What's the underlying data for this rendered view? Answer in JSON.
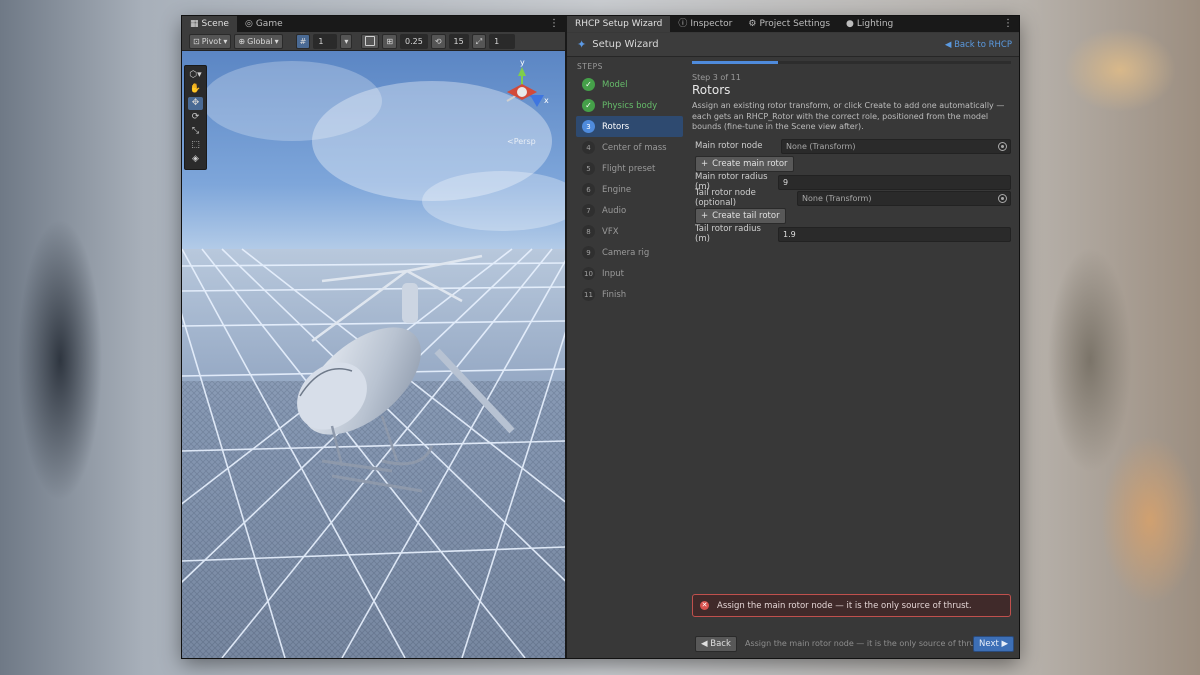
{
  "scene_panel": {
    "tabs": [
      {
        "label": "Scene",
        "icon": "grid-icon"
      },
      {
        "label": "Game",
        "icon": "gamepad-icon"
      }
    ],
    "toolbar": {
      "pivot": "Pivot",
      "global": "Global",
      "grid_value": "1",
      "snap_value": "0.25",
      "rotate_snap": "15",
      "scale_snap": "1"
    },
    "camera_mode": "<Persp"
  },
  "wizard_panel": {
    "tabs": [
      {
        "label": "RHCP Setup Wizard",
        "icon": ""
      },
      {
        "label": "Inspector",
        "icon": "info-icon"
      },
      {
        "label": "Project Settings",
        "icon": "gear-icon"
      },
      {
        "label": "Lighting",
        "icon": "bulb-icon"
      }
    ],
    "header": {
      "title": "Setup Wizard",
      "back_link": "◀ Back to RHCP"
    },
    "progress": 0.27,
    "steps_heading": "STEPS",
    "steps": [
      {
        "num": "✓",
        "label": "Model",
        "state": "done"
      },
      {
        "num": "✓",
        "label": "Physics body",
        "state": "done"
      },
      {
        "num": "3",
        "label": "Rotors",
        "state": "active"
      },
      {
        "num": "4",
        "label": "Center of mass",
        "state": "pending"
      },
      {
        "num": "5",
        "label": "Flight preset",
        "state": "pending"
      },
      {
        "num": "6",
        "label": "Engine",
        "state": "pending"
      },
      {
        "num": "7",
        "label": "Audio",
        "state": "pending"
      },
      {
        "num": "8",
        "label": "VFX",
        "state": "pending"
      },
      {
        "num": "9",
        "label": "Camera rig",
        "state": "pending"
      },
      {
        "num": "10",
        "label": "Input",
        "state": "pending"
      },
      {
        "num": "11",
        "label": "Finish",
        "state": "pending"
      }
    ],
    "content": {
      "step_count": "Step 3 of 11",
      "title": "Rotors",
      "description": "Assign an existing rotor transform, or click Create to add one automatically — each gets an RHCP_Rotor with the correct role, positioned from the model bounds (fine-tune in the Scene view after).",
      "main_rotor_label": "Main rotor node",
      "main_rotor_value": "None (Transform)",
      "create_main_label": "Create main rotor",
      "main_radius_label": "Main rotor radius (m)",
      "main_radius_value": "9",
      "tail_rotor_label": "Tail rotor node (optional)",
      "tail_rotor_value": "None (Transform)",
      "create_tail_label": "Create tail rotor",
      "tail_radius_label": "Tail rotor radius (m)",
      "tail_radius_value": "1.9"
    },
    "error_message": "Assign the main rotor node — it is the only source of thrust.",
    "footer": {
      "back_label": "◀ Back",
      "message": "Assign the main rotor node — it is the only source of thrust.",
      "next_label": "Next ▶"
    }
  },
  "colors": {
    "accent": "#4f8bdc",
    "success": "#45a049",
    "error": "#d9534f"
  }
}
